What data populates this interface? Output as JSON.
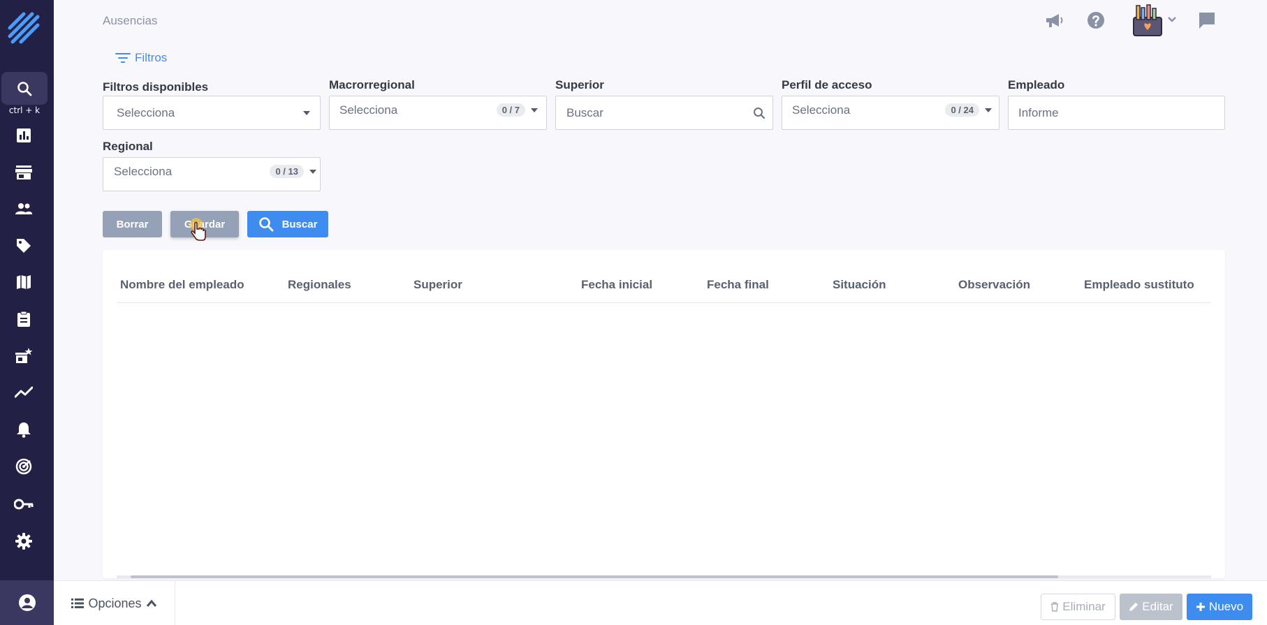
{
  "page": {
    "title": "Ausencias"
  },
  "sidebar": {
    "search_hint": "ctrl + k",
    "items": [
      {
        "name": "dashboard-icon"
      },
      {
        "name": "store-icon"
      },
      {
        "name": "users-icon"
      },
      {
        "name": "tag-icon"
      },
      {
        "name": "map-icon"
      },
      {
        "name": "clipboard-icon"
      },
      {
        "name": "featured-store-icon"
      },
      {
        "name": "trend-icon"
      },
      {
        "name": "bell-icon"
      },
      {
        "name": "radar-icon"
      },
      {
        "name": "key-icon"
      },
      {
        "name": "gear-icon"
      }
    ]
  },
  "filters": {
    "toggle_label": "Filtros",
    "available": {
      "label": "Filtros disponibles",
      "placeholder": "Selecciona"
    },
    "macroregional": {
      "label": "Macrorregional",
      "placeholder": "Selecciona",
      "count": "0 / 7"
    },
    "superior": {
      "label": "Superior",
      "placeholder": "Buscar"
    },
    "perfil": {
      "label": "Perfil de acceso",
      "placeholder": "Selecciona",
      "count": "0 / 24"
    },
    "empleado": {
      "label": "Empleado",
      "placeholder": "Informe"
    },
    "regional": {
      "label": "Regional",
      "placeholder": "Selecciona",
      "count": "0 / 13"
    }
  },
  "actions": {
    "clear": "Borrar",
    "save": "Guardar",
    "search": "Buscar"
  },
  "table": {
    "columns": [
      "Nombre del empleado",
      "Regionales",
      "Superior",
      "Fecha inicial",
      "Fecha final",
      "Situación",
      "Observación",
      "Empleado sustituto"
    ],
    "rows": []
  },
  "bottombar": {
    "options": "Opciones",
    "delete": "Eliminar",
    "edit": "Editar",
    "new": "Nuevo"
  },
  "colors": {
    "sidebar": "#232046",
    "primary": "#3f8cf0",
    "muted_button": "#94a1b6"
  }
}
